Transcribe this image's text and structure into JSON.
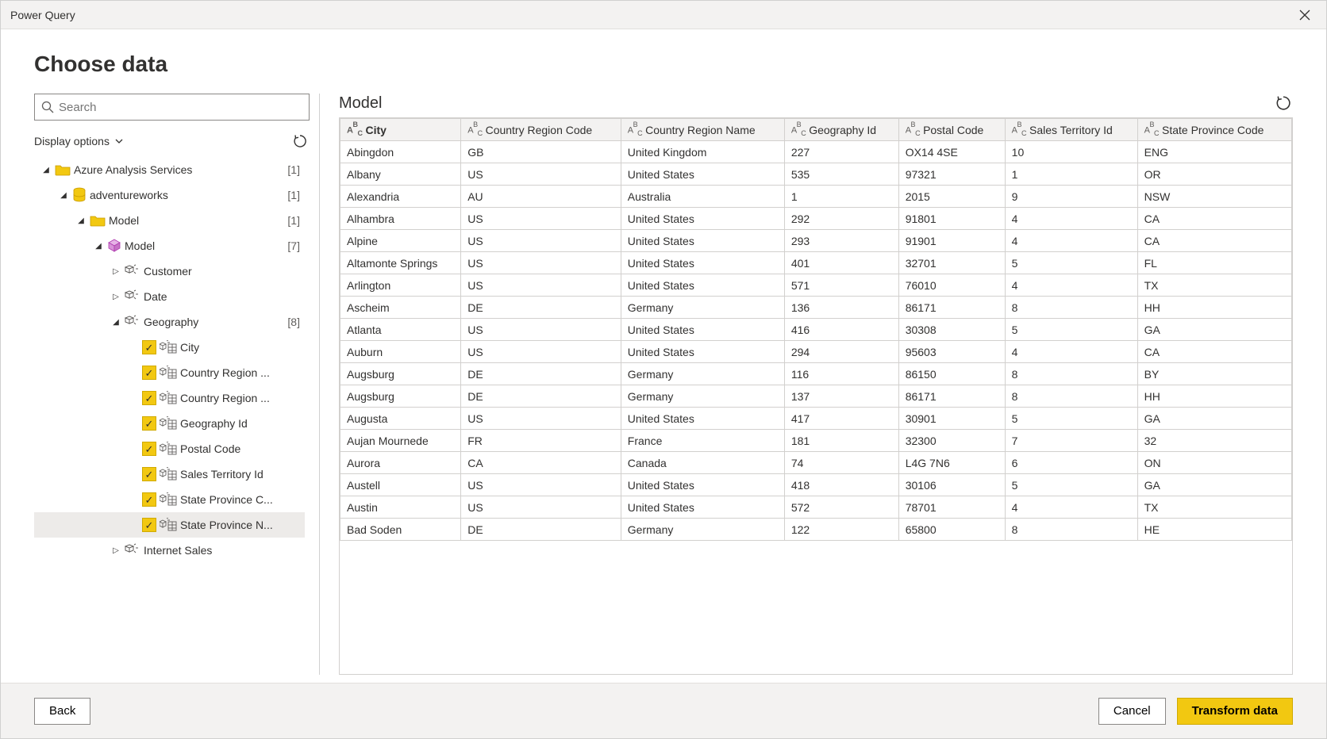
{
  "window_title": "Power Query",
  "page_title": "Choose data",
  "search": {
    "placeholder": "Search"
  },
  "display_options_label": "Display options",
  "nav": {
    "items": [
      {
        "depth": 0,
        "icon": "folder",
        "label": "Azure Analysis Services",
        "count": "[1]",
        "expanded": true,
        "checkbox": null
      },
      {
        "depth": 1,
        "icon": "database",
        "label": "adventureworks",
        "count": "[1]",
        "expanded": true,
        "checkbox": null
      },
      {
        "depth": 2,
        "icon": "folder",
        "label": "Model",
        "count": "[1]",
        "expanded": true,
        "checkbox": null
      },
      {
        "depth": 3,
        "icon": "cube",
        "label": "Model",
        "count": "[7]",
        "expanded": true,
        "checkbox": null
      },
      {
        "depth": 4,
        "icon": "dim",
        "label": "Customer",
        "count": "",
        "expanded": false,
        "checkbox": null
      },
      {
        "depth": 4,
        "icon": "dim",
        "label": "Date",
        "count": "",
        "expanded": false,
        "checkbox": null
      },
      {
        "depth": 4,
        "icon": "dim",
        "label": "Geography",
        "count": "[8]",
        "expanded": true,
        "checkbox": null
      },
      {
        "depth": 5,
        "icon": "column",
        "label": "City",
        "count": "",
        "checkbox": "checked"
      },
      {
        "depth": 5,
        "icon": "column",
        "label": "Country Region ...",
        "count": "",
        "checkbox": "checked"
      },
      {
        "depth": 5,
        "icon": "column",
        "label": "Country Region ...",
        "count": "",
        "checkbox": "checked"
      },
      {
        "depth": 5,
        "icon": "column",
        "label": "Geography Id",
        "count": "",
        "checkbox": "checked"
      },
      {
        "depth": 5,
        "icon": "column",
        "label": "Postal Code",
        "count": "",
        "checkbox": "checked"
      },
      {
        "depth": 5,
        "icon": "column",
        "label": "Sales Territory Id",
        "count": "",
        "checkbox": "checked"
      },
      {
        "depth": 5,
        "icon": "column",
        "label": "State Province C...",
        "count": "",
        "checkbox": "checked"
      },
      {
        "depth": 5,
        "icon": "column",
        "label": "State Province N...",
        "count": "",
        "checkbox": "checked",
        "selected": true
      },
      {
        "depth": 4,
        "icon": "dim",
        "label": "Internet Sales",
        "count": "",
        "expanded": false,
        "checkbox": null
      }
    ]
  },
  "preview": {
    "name": "Model",
    "columns": [
      "City",
      "Country Region Code",
      "Country Region Name",
      "Geography Id",
      "Postal Code",
      "Sales Territory Id",
      "State Province Code"
    ],
    "sort_column_index": 0,
    "rows": [
      [
        "Abingdon",
        "GB",
        "United Kingdom",
        "227",
        "OX14 4SE",
        "10",
        "ENG"
      ],
      [
        "Albany",
        "US",
        "United States",
        "535",
        "97321",
        "1",
        "OR"
      ],
      [
        "Alexandria",
        "AU",
        "Australia",
        "1",
        "2015",
        "9",
        "NSW"
      ],
      [
        "Alhambra",
        "US",
        "United States",
        "292",
        "91801",
        "4",
        "CA"
      ],
      [
        "Alpine",
        "US",
        "United States",
        "293",
        "91901",
        "4",
        "CA"
      ],
      [
        "Altamonte Springs",
        "US",
        "United States",
        "401",
        "32701",
        "5",
        "FL"
      ],
      [
        "Arlington",
        "US",
        "United States",
        "571",
        "76010",
        "4",
        "TX"
      ],
      [
        "Ascheim",
        "DE",
        "Germany",
        "136",
        "86171",
        "8",
        "HH"
      ],
      [
        "Atlanta",
        "US",
        "United States",
        "416",
        "30308",
        "5",
        "GA"
      ],
      [
        "Auburn",
        "US",
        "United States",
        "294",
        "95603",
        "4",
        "CA"
      ],
      [
        "Augsburg",
        "DE",
        "Germany",
        "116",
        "86150",
        "8",
        "BY"
      ],
      [
        "Augsburg",
        "DE",
        "Germany",
        "137",
        "86171",
        "8",
        "HH"
      ],
      [
        "Augusta",
        "US",
        "United States",
        "417",
        "30901",
        "5",
        "GA"
      ],
      [
        "Aujan Mournede",
        "FR",
        "France",
        "181",
        "32300",
        "7",
        "32"
      ],
      [
        "Aurora",
        "CA",
        "Canada",
        "74",
        "L4G 7N6",
        "6",
        "ON"
      ],
      [
        "Austell",
        "US",
        "United States",
        "418",
        "30106",
        "5",
        "GA"
      ],
      [
        "Austin",
        "US",
        "United States",
        "572",
        "78701",
        "4",
        "TX"
      ],
      [
        "Bad Soden",
        "DE",
        "Germany",
        "122",
        "65800",
        "8",
        "HE"
      ]
    ]
  },
  "buttons": {
    "back": "Back",
    "cancel": "Cancel",
    "transform": "Transform data"
  }
}
